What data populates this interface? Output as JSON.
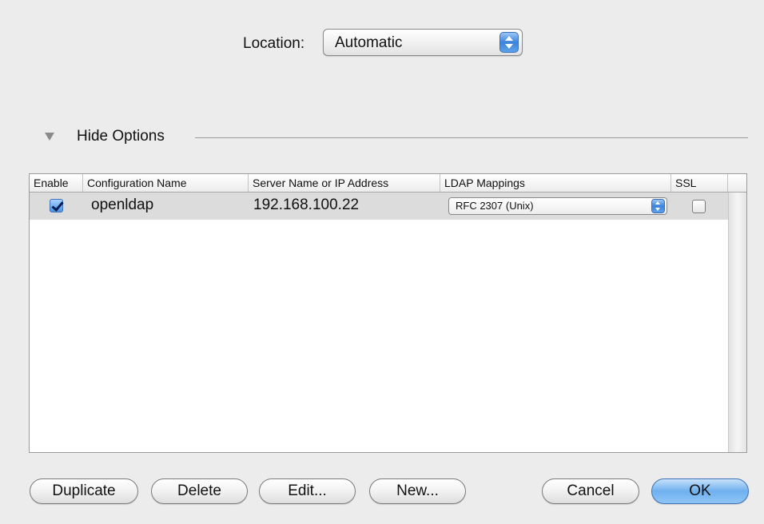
{
  "location": {
    "label": "Location:",
    "selected": "Automatic"
  },
  "options": {
    "label": "Hide Options"
  },
  "table": {
    "columns": [
      "Enable",
      "Configuration Name",
      "Server Name or IP Address",
      "LDAP Mappings",
      "SSL"
    ],
    "rows": [
      {
        "enabled": true,
        "configuration_name": "openldap",
        "server": "192.168.100.22",
        "ldap_mapping": "RFC 2307 (Unix)",
        "ssl": false
      }
    ]
  },
  "buttons": {
    "duplicate": "Duplicate",
    "delete": "Delete",
    "edit": "Edit...",
    "new": "New...",
    "cancel": "Cancel",
    "ok": "OK"
  },
  "colors": {
    "window_background": "#ececec",
    "selected_row": "#dcdcdc",
    "accent_blue": "#3b84dc"
  },
  "icons": {
    "location_stepper": "popup-arrows-icon",
    "disclosure": "disclosure-triangle-down-icon",
    "enable_checkbox": "checkbox-checked-icon",
    "ssl_checkbox": "checkbox-unchecked-icon"
  }
}
